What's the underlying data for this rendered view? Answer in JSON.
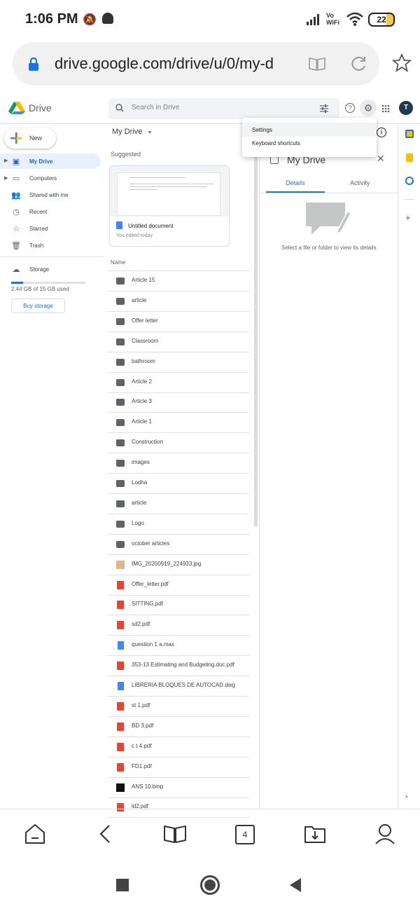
{
  "status": {
    "time": "1:06 PM",
    "battery": "22",
    "network": "Vo WiFi"
  },
  "browser": {
    "url": "drive.google.com/drive/u/0/my-d",
    "tabs_count": "4"
  },
  "drive": {
    "logo": "Drive",
    "search_placeholder": "Search in Drive",
    "avatar": "T",
    "new_label": "New",
    "sidebar": [
      {
        "label": "My Drive",
        "icon": "my-drive-icon",
        "active": true
      },
      {
        "label": "Computers",
        "icon": "computers-icon"
      },
      {
        "label": "Shared with me",
        "icon": "shared-icon"
      },
      {
        "label": "Recent",
        "icon": "clock-icon"
      },
      {
        "label": "Starred",
        "icon": "star-icon"
      },
      {
        "label": "Trash",
        "icon": "trash-icon"
      }
    ],
    "storage": {
      "label": "Storage",
      "used_text": "2.44 GB of 15 GB used",
      "fraction": 0.163,
      "buy_label": "Buy storage"
    },
    "main": {
      "title": "My Drive",
      "suggested": "Suggested",
      "suggested_card": {
        "title": "Untitled document",
        "subtitle": "You edited today"
      },
      "name_header": "Name",
      "files": [
        {
          "name": "Article 15",
          "type": "folder"
        },
        {
          "name": "article",
          "type": "folder"
        },
        {
          "name": "Offer letter",
          "type": "folder"
        },
        {
          "name": "Classroom",
          "type": "folder"
        },
        {
          "name": "bathroom",
          "type": "folder"
        },
        {
          "name": "Article 2",
          "type": "folder"
        },
        {
          "name": "Article 3",
          "type": "folder"
        },
        {
          "name": "Article 1",
          "type": "folder"
        },
        {
          "name": "Construction",
          "type": "folder"
        },
        {
          "name": "images",
          "type": "folder"
        },
        {
          "name": "Lodha",
          "type": "folder"
        },
        {
          "name": "article",
          "type": "folder"
        },
        {
          "name": "Logo",
          "type": "folder"
        },
        {
          "name": "october articles",
          "type": "folder"
        },
        {
          "name": "IMG_20200919_224933.jpg",
          "type": "img"
        },
        {
          "name": "Offer_letter.pdf",
          "type": "pdf"
        },
        {
          "name": "SITTING.pdf",
          "type": "pdf"
        },
        {
          "name": "sd2.pdf",
          "type": "pdf"
        },
        {
          "name": "question 1 a.max",
          "type": "docblue"
        },
        {
          "name": "353-13 Estimating and Budgeting.doc.pdf",
          "type": "pdf"
        },
        {
          "name": "LIBRERIA BLOQUES DE AUTOCAD.dwg",
          "type": "docblue"
        },
        {
          "name": "st 1.pdf",
          "type": "pdf"
        },
        {
          "name": "BD 3.pdf",
          "type": "pdf"
        },
        {
          "name": "c t 4.pdf",
          "type": "pdf"
        },
        {
          "name": "FD1.pdf",
          "type": "pdf"
        },
        {
          "name": "ANS 10.bmp",
          "type": "bmp"
        },
        {
          "name": "ld2.pdf",
          "type": "pdf"
        }
      ]
    },
    "details": {
      "title": "My Drive",
      "tab_details": "Details",
      "tab_activity": "Activity",
      "empty_text": "Select a file or folder to view its details"
    },
    "settings_menu": {
      "items": [
        "Settings",
        "Keyboard shortcuts"
      ]
    }
  },
  "colors": {
    "accent": "#1a73e8",
    "folder": "#5f6368",
    "pdf": "#ea4335",
    "doc": "#4285f4"
  }
}
